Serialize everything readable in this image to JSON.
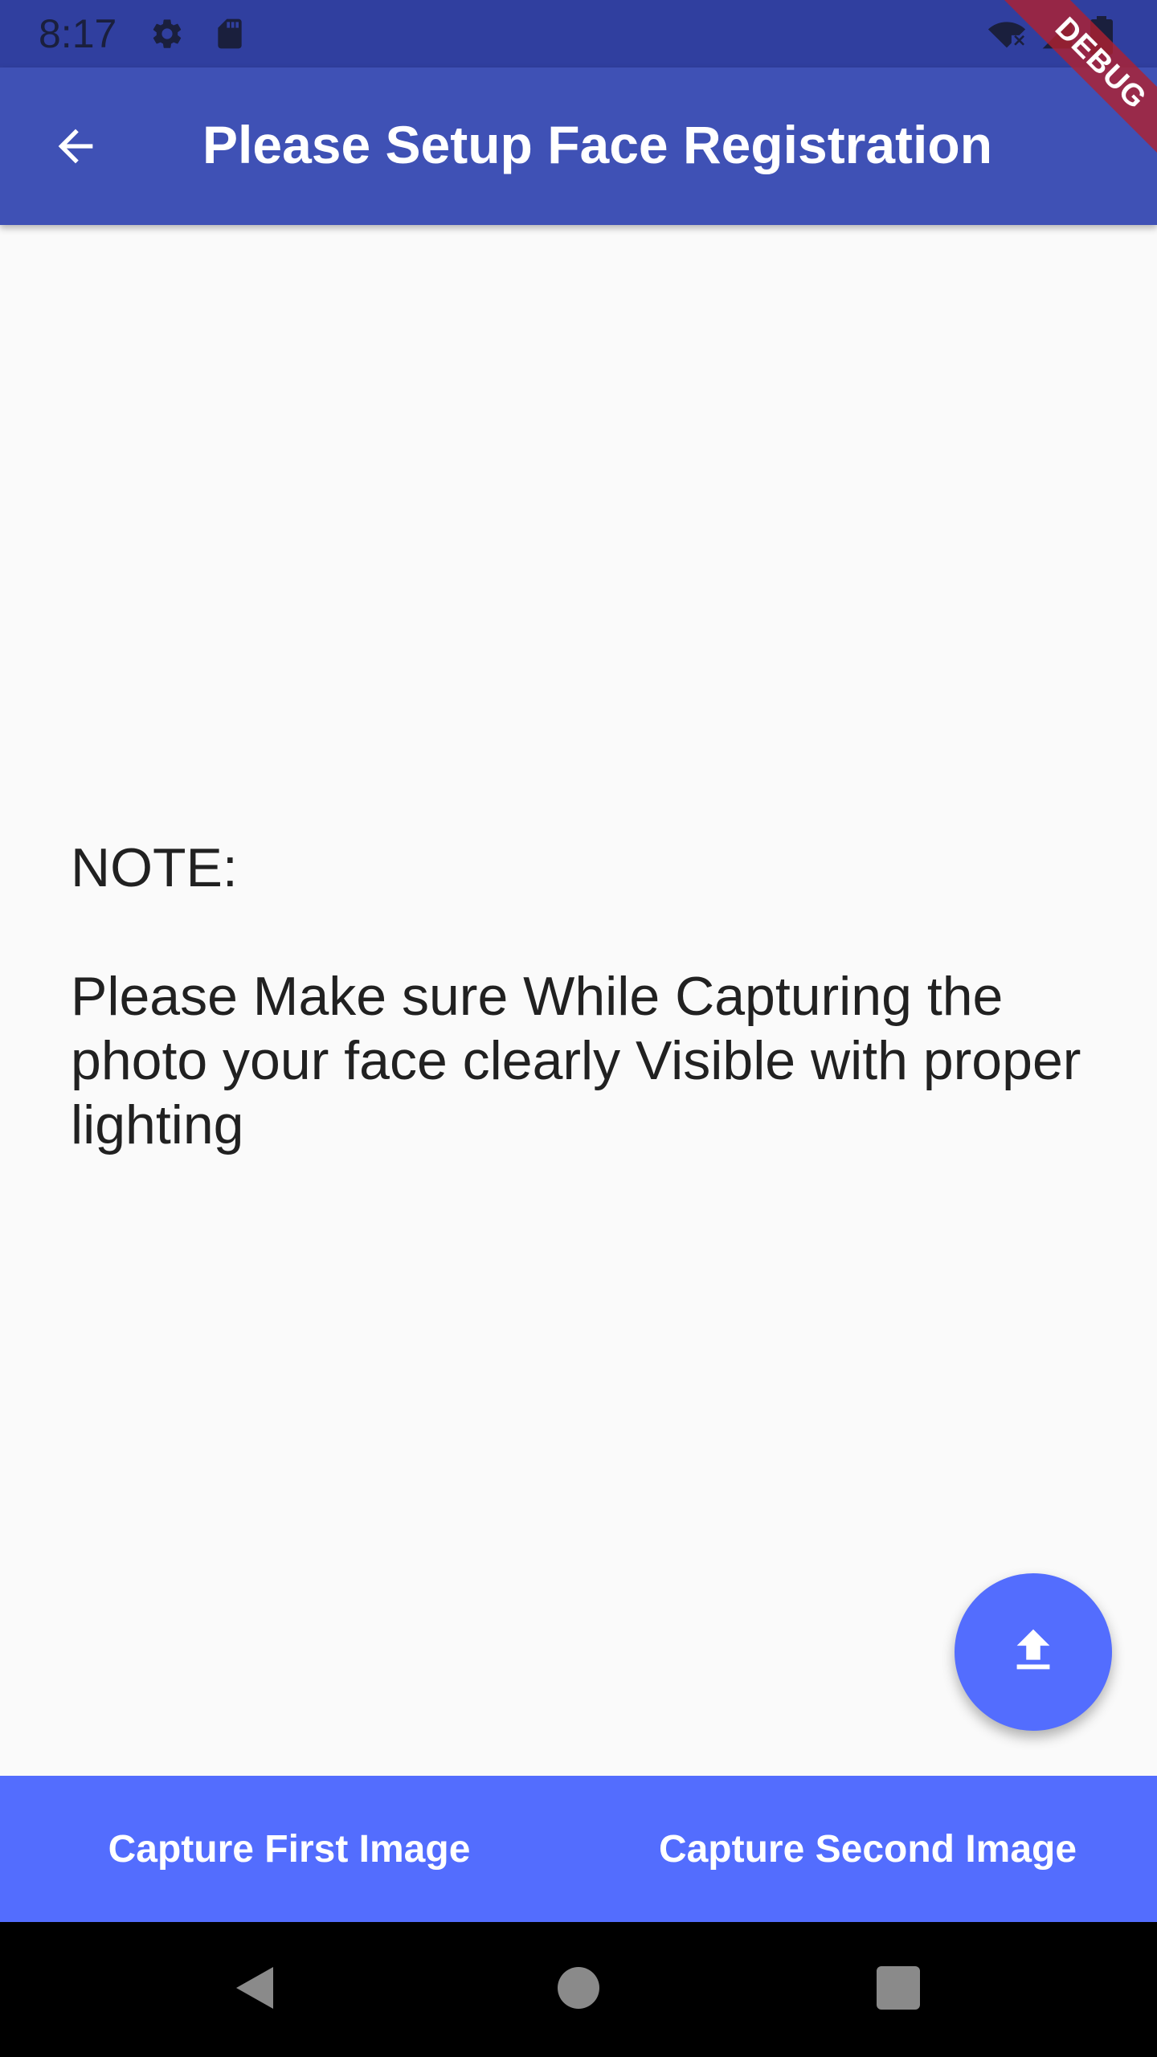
{
  "status_bar": {
    "time": "8:17",
    "left_icons": [
      "settings-icon",
      "sd-card-icon"
    ],
    "right_icons": [
      "wifi-off-icon",
      "signal-icon",
      "battery-icon"
    ]
  },
  "app_bar": {
    "title": "Please Setup Face Registration",
    "back_icon": "arrow-back-icon",
    "color": "#3f51b5"
  },
  "debug_banner": {
    "label": "DEBUG"
  },
  "note": {
    "label": "NOTE:",
    "text": "Please Make sure While Capturing the photo your face clearly Visible with proper lighting"
  },
  "fab": {
    "icon": "upload-icon",
    "color": "#536dfe"
  },
  "bottom_bar": {
    "first_button": "Capture First Image",
    "second_button": "Capture Second Image",
    "color": "#536dfe"
  },
  "nav_bar": {
    "icons": [
      "back-triangle-icon",
      "home-circle-icon",
      "recents-square-icon"
    ]
  }
}
